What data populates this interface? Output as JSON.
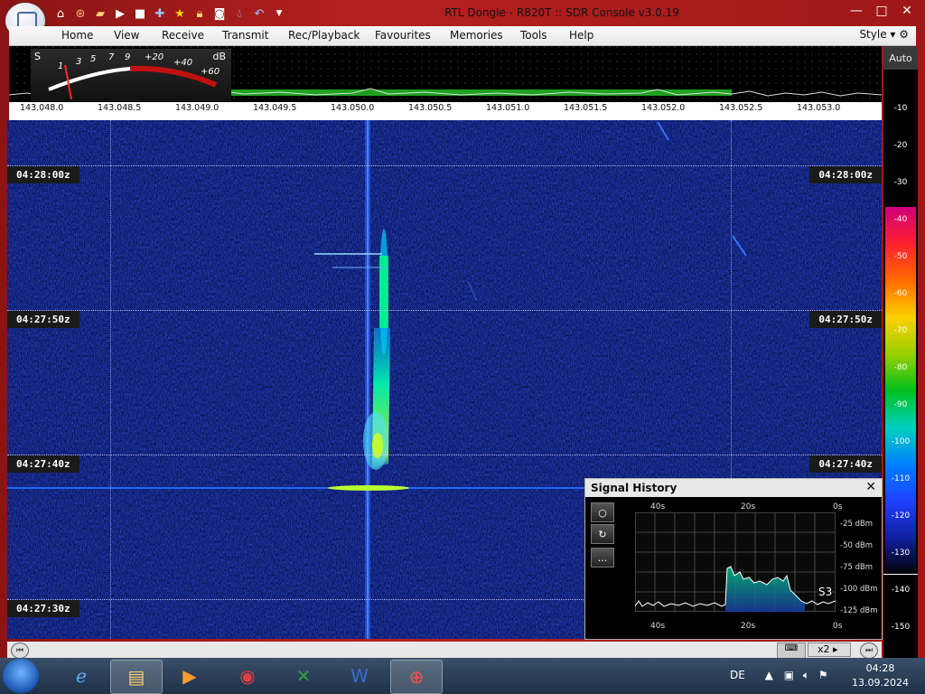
{
  "window": {
    "title": "RTL Dongle - R820T :: SDR Console v3.0.19",
    "controls": {
      "minimize": "—",
      "maximize": "□",
      "close": "✕"
    }
  },
  "quick_access": [
    "home-icon",
    "lifebuoy-icon",
    "folder-icon",
    "play-icon",
    "stop-icon",
    "add-icon",
    "star-icon",
    "lock-icon",
    "camera-icon",
    "drop-icon",
    "undo-icon",
    "dropdown-icon"
  ],
  "menu": {
    "items": [
      "Home",
      "View",
      "Receive",
      "Transmit",
      "Rec/Playback",
      "Favourites",
      "Memories",
      "Tools",
      "Help"
    ],
    "style_label": "Style"
  },
  "meter": {
    "s_label": "S",
    "db_label": "dB",
    "s_ticks": [
      "1",
      "3",
      "5",
      "7",
      "9"
    ],
    "db_ticks": [
      "+20",
      "+40",
      "+60"
    ]
  },
  "frequency_axis": [
    "143.048.0",
    "143.048.5",
    "143.049.0",
    "143.049.5",
    "143.050.0",
    "143.050.5",
    "143.051.0",
    "143.051.5",
    "143.052.0",
    "143.052.5",
    "143.053.0"
  ],
  "colour_scale": {
    "auto_label": "Auto",
    "levels": [
      "-10",
      "-20",
      "-30",
      "-40",
      "-50",
      "-60",
      "-70",
      "-80",
      "-90",
      "-100",
      "-110",
      "-120",
      "-130",
      "-140",
      "-150"
    ]
  },
  "waterfall": {
    "time_labels": [
      "04:28:00z",
      "04:27:50z",
      "04:27:40z",
      "04:27:30z"
    ]
  },
  "signal_history": {
    "title": "Signal History",
    "close": "✕",
    "x_top": [
      "40s",
      "20s",
      "0s"
    ],
    "x_bottom": [
      "40s",
      "20s",
      "0s"
    ],
    "y_labels": [
      "-25 dBm",
      "-50 dBm",
      "-75 dBm",
      "-100 dBm",
      "-125 dBm"
    ],
    "s_reading": "S3",
    "buttons": [
      "○",
      "↻",
      "..."
    ]
  },
  "bottom_strip": {
    "zoom": "x2"
  },
  "taskbar": {
    "apps": [
      "internet-explorer-icon",
      "file-explorer-icon",
      "media-player-icon",
      "chrome-icon",
      "excel-icon",
      "word-icon",
      "sdr-console-icon"
    ],
    "language": "DE",
    "time": "04:28",
    "date": "13.09.2024"
  }
}
